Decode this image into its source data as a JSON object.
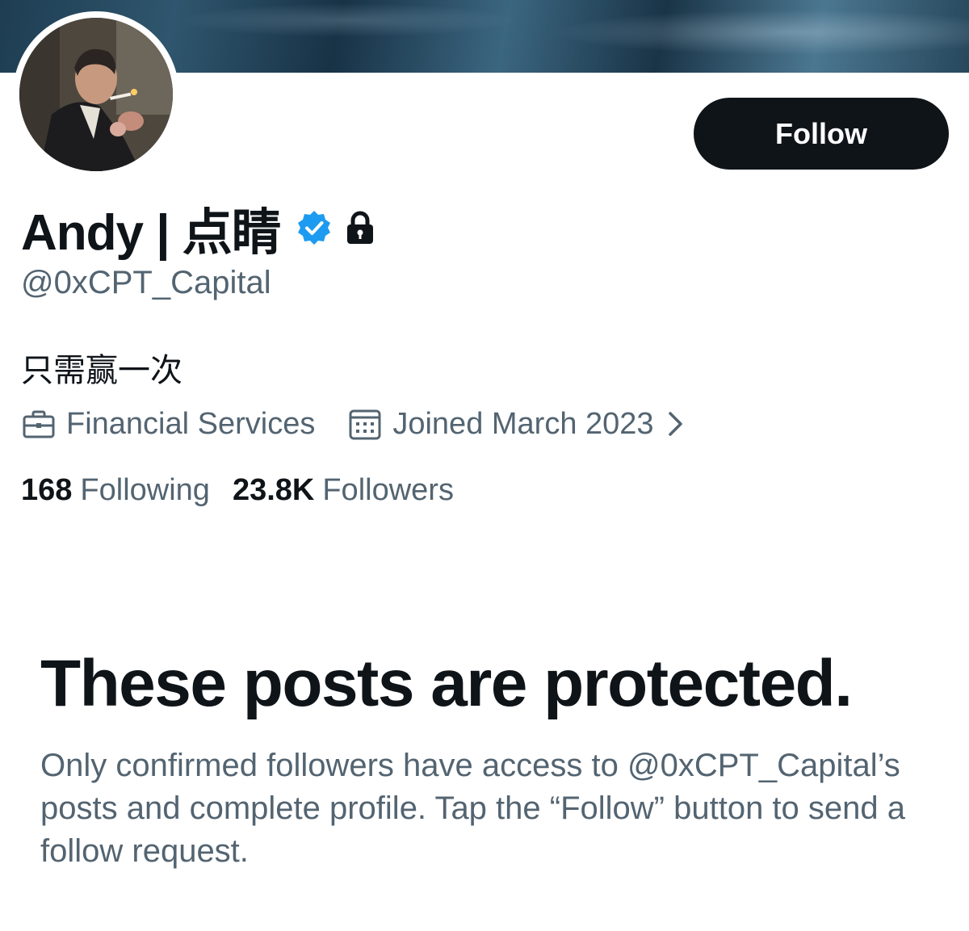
{
  "profile": {
    "display_name": "Andy | 点睛",
    "handle": "@0xCPT_Capital",
    "bio": "只需赢一次",
    "verified_icon": "verified-badge-icon",
    "lock_icon": "lock-icon",
    "verified_color": "#1d9bf0"
  },
  "follow_button": {
    "label": "Follow"
  },
  "meta": {
    "category": "Financial Services",
    "category_icon": "briefcase-icon",
    "joined": "Joined March 2023",
    "joined_icon": "calendar-icon",
    "chevron_icon": "chevron-right-icon"
  },
  "stats": {
    "following_count": "168",
    "following_label": "Following",
    "followers_count": "23.8K",
    "followers_label": "Followers"
  },
  "protected": {
    "title": "These posts are protected.",
    "description": "Only confirmed followers have access to @0xCPT_Capital’s posts and complete profile. Tap the “Follow” button to send a follow request."
  },
  "colors": {
    "text_primary": "#0f1419",
    "text_secondary": "#536471",
    "button_bg": "#0f1419"
  }
}
